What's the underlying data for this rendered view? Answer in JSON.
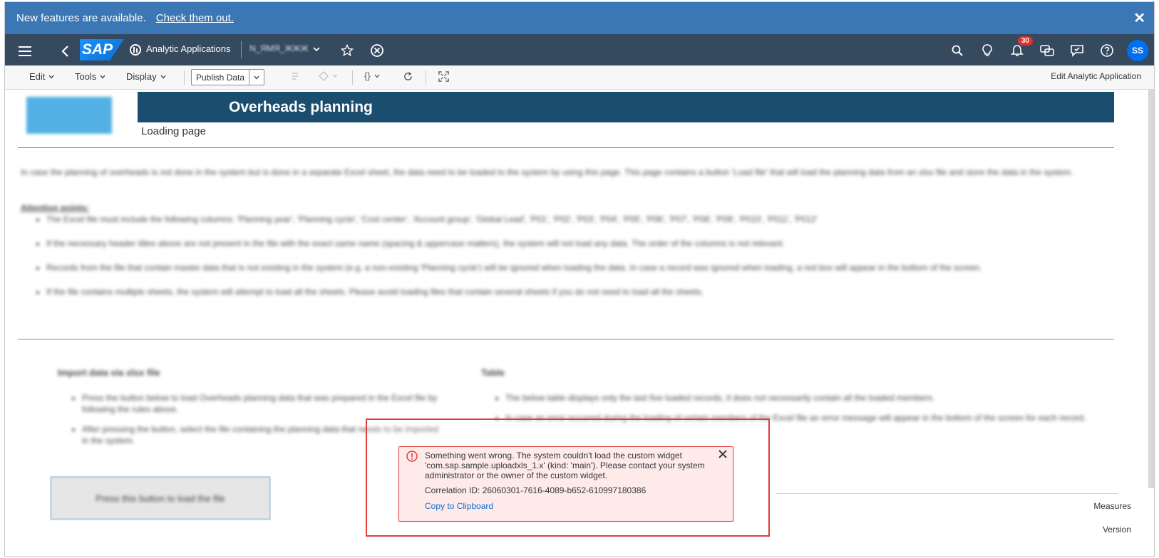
{
  "banner": {
    "message": "New features are available.",
    "link": "Check them out.",
    "close": "✕"
  },
  "shell": {
    "logo": "SAP",
    "app_title": "Analytic Applications",
    "file_name": "N_ЯМЯ_ЖЖЖ",
    "notifications_count": "30",
    "avatar_initials": "SS"
  },
  "toolbar": {
    "edit": "Edit",
    "tools": "Tools",
    "display": "Display",
    "publish": "Publish Data",
    "braces": "{}",
    "edit_app": "Edit Analytic Application"
  },
  "page": {
    "logo_text": "",
    "title": "Overheads planning",
    "loading": "Loading page",
    "intro": "In case the planning of overheads is not done in the system but is done in a separate Excel sheet, the data need to be loaded to the system by using this page. This page contains a button 'Load file' that will load the planning data from an xlsx file and store the data in the system.",
    "attention": "Attention points:",
    "bullets": [
      "The Excel file must include the following columns: 'Planning year', 'Planning cycle', 'Cost center', 'Account group', 'Global Lead', 'P01', 'P02', 'P03', 'P04', 'P05', 'P06', 'P07', 'P08', 'P09', 'P010', 'P011', 'P012'",
      "If the necessary header titles above are not present in the file with the exact same name (spacing & uppercase matters), the system will not load any data. The order of the columns is not relevant.",
      "Records from the file that contain master data that is not existing in the system (e.g. a non-existing 'Planning cycle') will be ignored when loading the data. In case a record was ignored when loading, a red box will appear in the bottom of the screen.",
      "If the file contains multiple sheets, the system will attempt to load all the sheets. Please avoid loading files that contain several sheets if you do not need to load all the sheets."
    ],
    "import_title": "Import data via xlsx file",
    "import_bullets": [
      "Press the button below to load Overheads planning data that was prepared in the Excel file by following the rules above.",
      "After pressing the button, select the file containing the planning data that needs to be imported in the system."
    ],
    "table_title": "Table",
    "table_bullets": [
      "The below table displays only the last five loaded records, it does not necessarily contain all the loaded members.",
      "In case an error occurred during the loading of certain members of the Excel file an error message will appear in the bottom of the screen for each record."
    ],
    "upload_button": "Press this button to load the file",
    "measures": "Measures",
    "version": "Version"
  },
  "error": {
    "message": "Something went wrong. The system couldn't load the custom widget 'com.sap.sample.uploadxls_1.x' (kind: 'main'). Please contact your system administrator or the owner of the custom widget.",
    "correlation": "Correlation ID: 26060301-7616-4089-b652-610997180386",
    "copy": "Copy to Clipboard"
  }
}
